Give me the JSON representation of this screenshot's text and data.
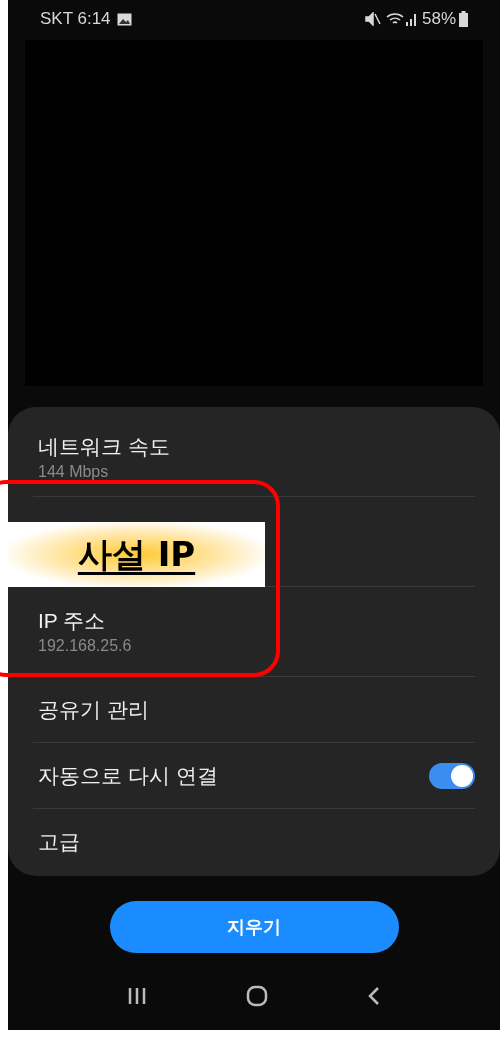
{
  "status_bar": {
    "carrier_time": "SKT 6:14",
    "battery": "58%"
  },
  "details": [
    {
      "kind": "info",
      "title": "네트워크 속도",
      "value": "144 Mbps"
    },
    {
      "kind": "covered"
    },
    {
      "kind": "info",
      "title": "IP 주소",
      "value": "192.168.25.6"
    },
    {
      "kind": "link",
      "title": "공유기 관리"
    },
    {
      "kind": "toggle",
      "title": "자동으로 다시 연결",
      "on": true
    },
    {
      "kind": "link",
      "title": "고급"
    }
  ],
  "clear_button": "지우기",
  "annotation": {
    "label": "사설 IP"
  }
}
